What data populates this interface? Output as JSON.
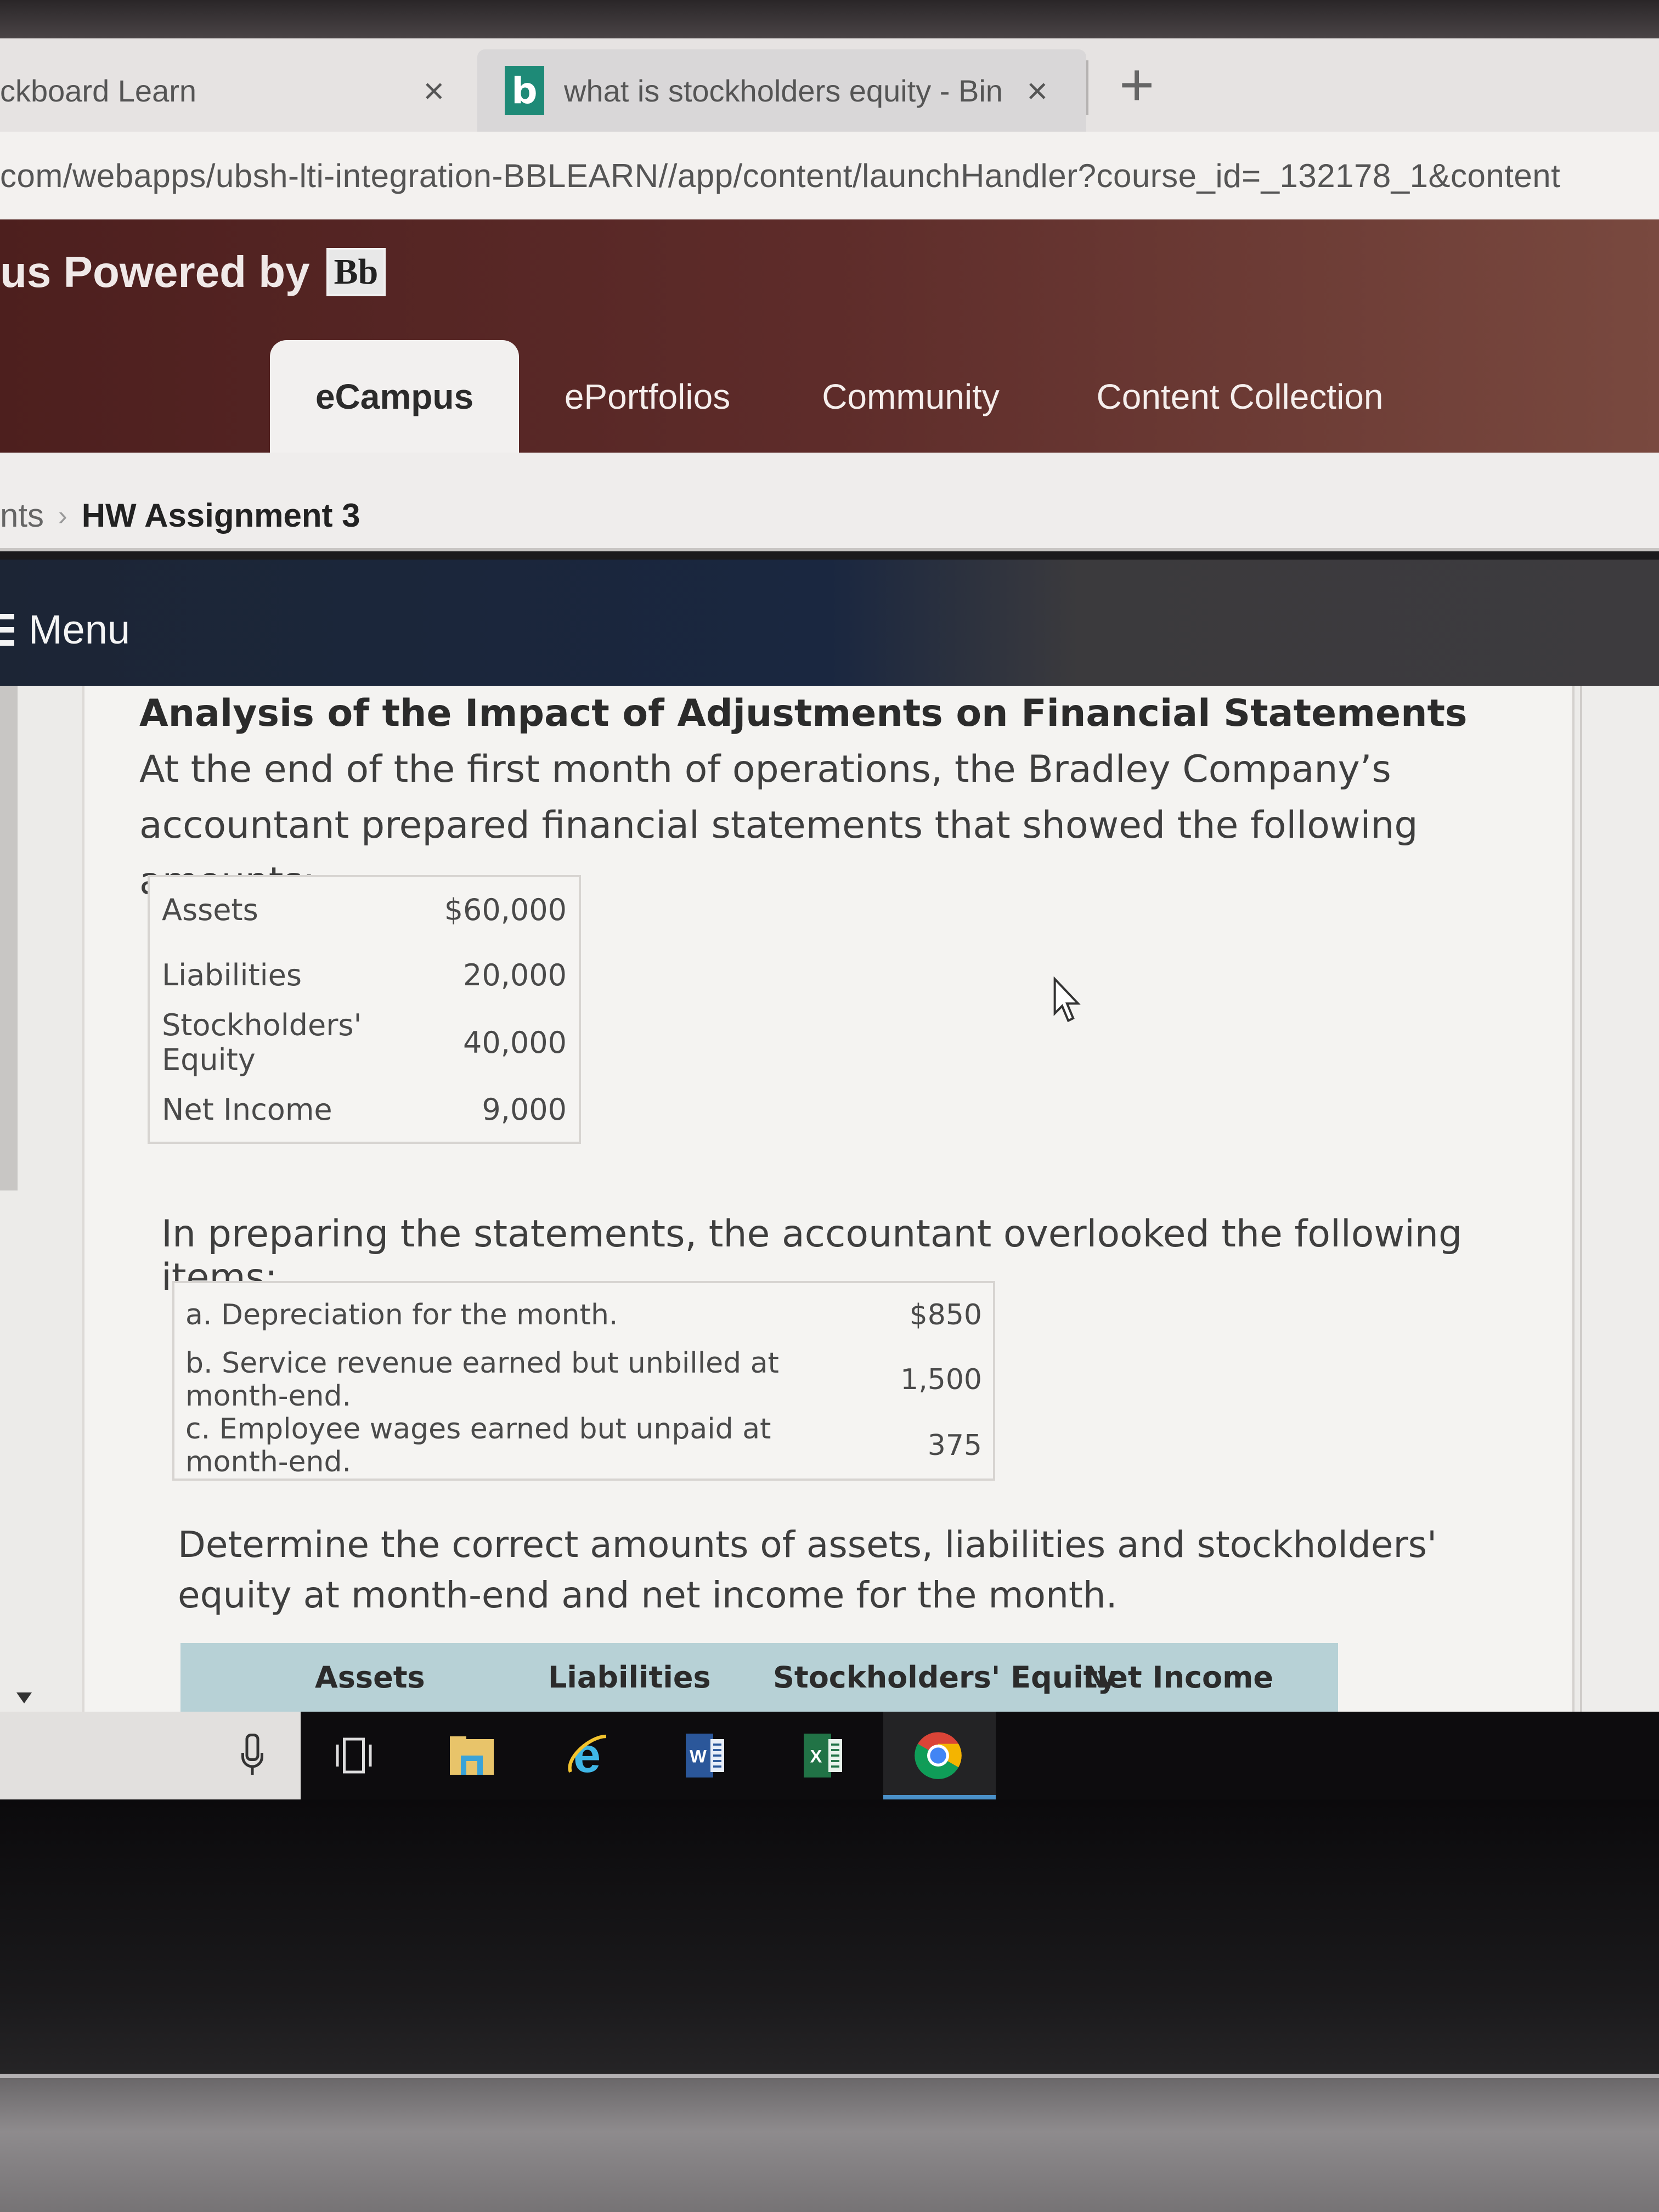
{
  "browser": {
    "tabs": [
      {
        "title": "ckboard Learn",
        "active": false,
        "close_icon": "×"
      },
      {
        "title": "what is stockholders equity - Bin",
        "active": true,
        "favicon": "b",
        "close_icon": "×"
      }
    ],
    "new_tab_icon": "+",
    "url": "com/webapps/ubsh-lti-integration-BBLEARN//app/content/launchHandler?course_id=_132178_1&content"
  },
  "header": {
    "brand_text": "us Powered by",
    "brand_logo": "Bb",
    "nav_tabs": [
      {
        "label": "eCampus",
        "active": true
      },
      {
        "label": "ePortfolios",
        "active": false
      },
      {
        "label": "Community",
        "active": false
      },
      {
        "label": "Content Collection",
        "active": false
      }
    ]
  },
  "breadcrumb": {
    "previous": "nts",
    "separator": "›",
    "current": "HW Assignment 3"
  },
  "menu": {
    "label": "Menu"
  },
  "content": {
    "title_bold": "Analysis of the Impact of Adjustments on Financial Statements",
    "intro_text": " At the end of the first month of operations, the Bradley Company’s accountant prepared financial statements that showed the following amounts:",
    "amounts": [
      {
        "label": "Assets",
        "value": "$60,000"
      },
      {
        "label": "Liabilities",
        "value": "20,000"
      },
      {
        "label": "Stockholders' Equity",
        "value": "40,000"
      },
      {
        "label": "Net Income",
        "value": "9,000"
      }
    ],
    "overlooked_intro": "In preparing the statements, the accountant overlooked the following items:",
    "overlooked_items": [
      {
        "label": "a. Depreciation for the month.",
        "value": "$850"
      },
      {
        "label": "b. Service revenue earned but unbilled at month-end.",
        "value": "1,500"
      },
      {
        "label": "c. Employee wages earned but unpaid at month-end.",
        "value": "375"
      }
    ],
    "instruction": "Determine the correct amounts of assets, liabilities and stockholders' equity at month-end and net income for the month.",
    "answer_headers": [
      "Assets",
      "Liabilities",
      "Stockholders' Equity",
      "Net Income"
    ]
  },
  "taskbar": {
    "icons": [
      "microphone-icon",
      "task-view-icon",
      "file-explorer-icon",
      "internet-explorer-icon",
      "word-icon",
      "excel-icon",
      "chrome-icon"
    ],
    "active": "chrome-icon",
    "word_letter": "W",
    "excel_letter": "X",
    "ie_letter": "e"
  },
  "colors": {
    "header_bg": "#5e2c2a",
    "menu_bar_bg": "#1a2740",
    "answer_header_bg": "#b7d1d6",
    "bing_green": "#1e8a77",
    "taskbar_active": "#4a90c8"
  }
}
